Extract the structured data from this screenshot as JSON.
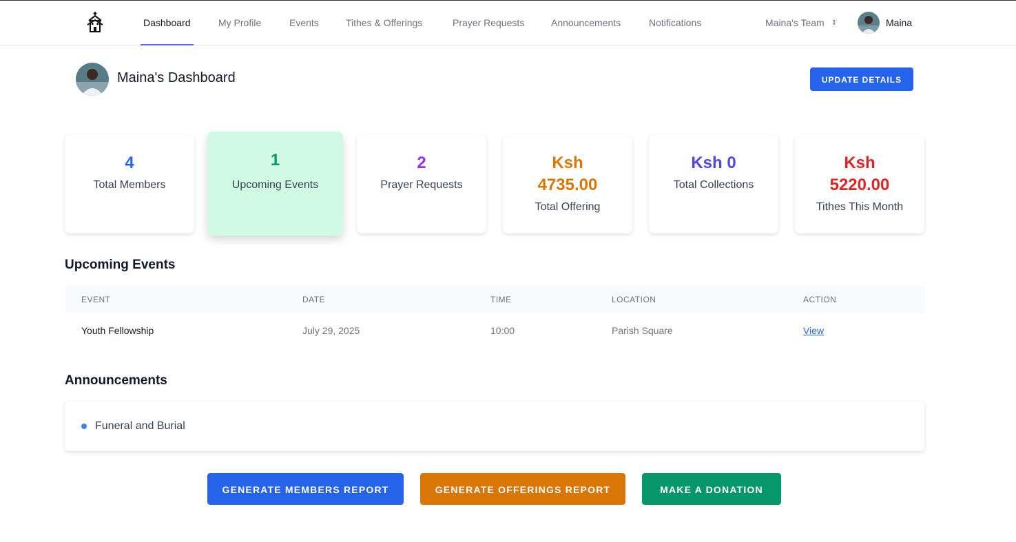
{
  "nav": {
    "items": [
      {
        "label": "Dashboard",
        "active": true
      },
      {
        "label": "My Profile"
      },
      {
        "label": "Events"
      },
      {
        "label": "Tithes & Offerings"
      },
      {
        "label": "Prayer Requests"
      },
      {
        "label": "Announcements"
      },
      {
        "label": "Notifications"
      }
    ],
    "team": "Maina's Team",
    "user": "Maina",
    "logo_icon": "church-icon"
  },
  "header": {
    "title": "Maina's Dashboard",
    "update_button": "UPDATE DETAILS"
  },
  "stats": [
    {
      "value": "4",
      "label": "Total Members",
      "color": "#2563eb"
    },
    {
      "value": "1",
      "label": "Upcoming Events",
      "color": "#059669",
      "highlight": "#d1fae5"
    },
    {
      "value": "2",
      "label": "Prayer Requests",
      "color": "#9333ea"
    },
    {
      "value_line1": "Ksh",
      "value_line2": "4735.00",
      "label": "Total Offering",
      "color": "#d97706"
    },
    {
      "value": "Ksh 0",
      "label": "Total Collections",
      "color": "#4f46e5"
    },
    {
      "value_line1": "Ksh",
      "value_line2": "5220.00",
      "label": "Tithes This Month",
      "color": "#dc2626"
    }
  ],
  "events": {
    "title": "Upcoming Events",
    "columns": [
      "EVENT",
      "DATE",
      "TIME",
      "LOCATION",
      "ACTION"
    ],
    "rows": [
      {
        "event": "Youth Fellowship",
        "date": "July 29, 2025",
        "time": "10:00",
        "location": "Parish Square",
        "action": "View"
      }
    ]
  },
  "announcements": {
    "title": "Announcements",
    "items": [
      "Funeral and Burial"
    ]
  },
  "actions": [
    {
      "label": "GENERATE MEMBERS REPORT",
      "color": "#2563eb"
    },
    {
      "label": "GENERATE OFFERINGS REPORT",
      "color": "#d97706"
    },
    {
      "label": "MAKE A DONATION",
      "color": "#059669"
    }
  ]
}
